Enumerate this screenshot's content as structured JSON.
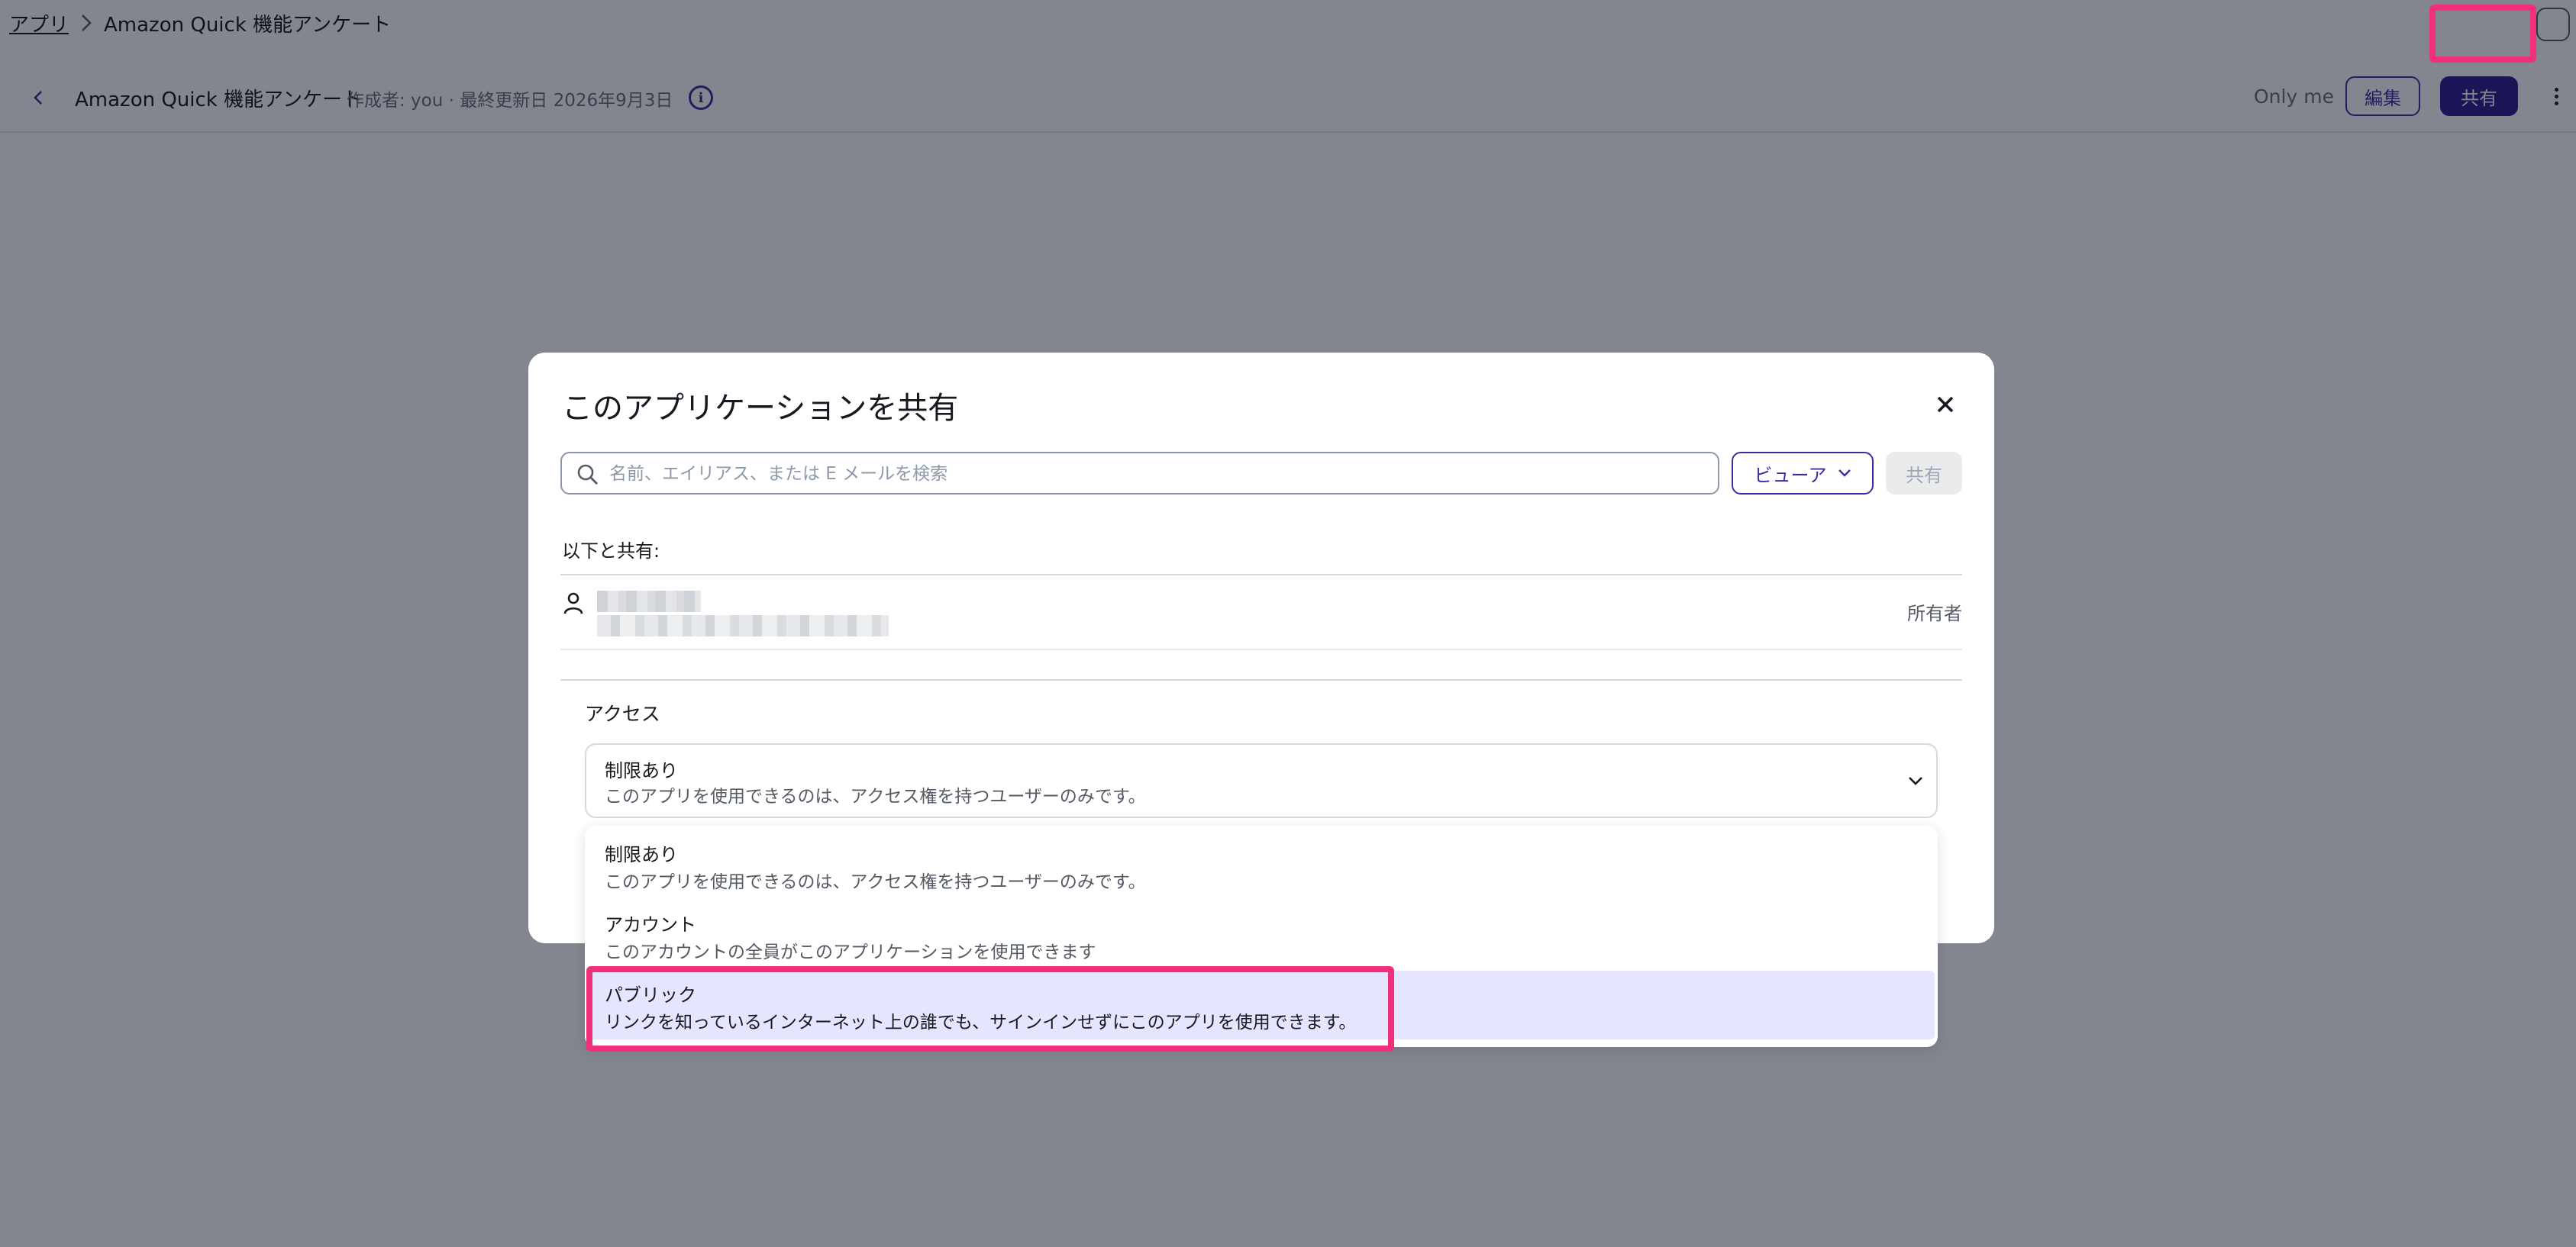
{
  "breadcrumb": {
    "root": "アプリ",
    "current": "Amazon Quick 機能アンケート"
  },
  "app_bar": {
    "title": "Amazon Quick 機能アンケート",
    "meta": "作成者: you · 最終更新日 2026年9月3日",
    "visibility": "Only me",
    "edit_label": "編集",
    "share_label": "共有"
  },
  "icons": {
    "back": "chevron-left-icon",
    "info": "info-icon",
    "chat": "chat-icon",
    "more": "more-vertical-icon",
    "close": "close-icon",
    "search": "search-icon",
    "person": "person-icon",
    "chevron": "chevron-down-icon"
  },
  "modal": {
    "title": "このアプリケーションを共有",
    "search_placeholder": "名前、エイリアス、または E メールを検索",
    "role_button": "ビューア",
    "share_button": "共有",
    "shared_with_label": "以下と共有:",
    "owner_role": "所有者",
    "access_label": "アクセス",
    "access_selected": {
      "title": "制限あり",
      "description": "このアプリを使用できるのは、アクセス権を持つユーザーのみです。"
    }
  },
  "access_options": [
    {
      "title": "制限あり",
      "description": "このアプリを使用できるのは、アクセス権を持つユーザーのみです。"
    },
    {
      "title": "アカウント",
      "description": "このアカウントの全員がこのアプリケーションを使用できます"
    },
    {
      "title": "パブリック",
      "description": "リンクを知っているインターネット上の誰でも、サインインせずにこのアプリを使用できます。"
    }
  ],
  "colors": {
    "primary": "#2e1a8f",
    "accent": "#3b2ea0",
    "highlight_frame": "#f0307a",
    "option_hover": "#e6e5ff"
  }
}
